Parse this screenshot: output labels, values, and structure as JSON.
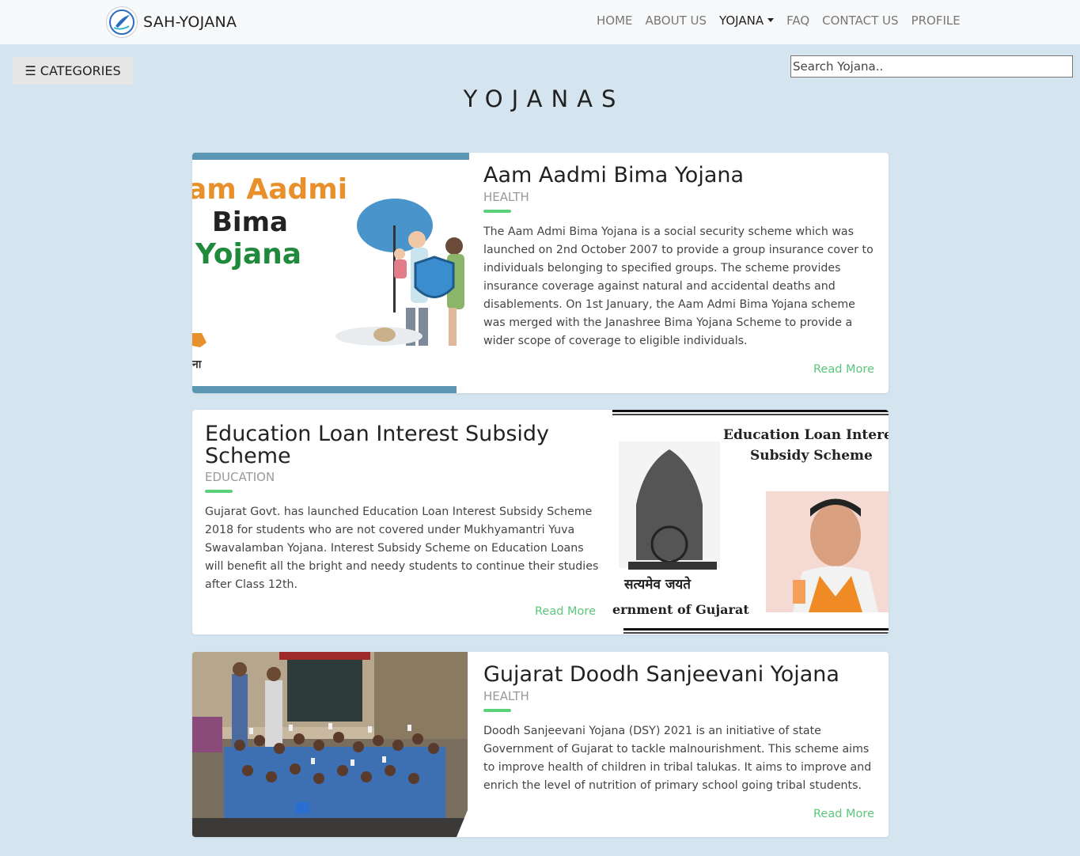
{
  "brand": {
    "name": "SAH-YOJANA"
  },
  "nav": [
    "HOME",
    "ABOUT US",
    "YOJANA",
    "FAQ",
    "CONTACT US",
    "PROFILE"
  ],
  "categories_button": "☰ CATEGORIES",
  "search": {
    "placeholder": "Search Yojana.."
  },
  "page_title": "YOJANAS",
  "cards": [
    {
      "title": "Aam Aadmi Bima Yojana",
      "category": "HEALTH",
      "description": "The Aam Admi Bima Yojana is a social security scheme which was launched on 2nd October 2007 to provide a group insurance cover to individuals belonging to specified groups. The scheme provides insurance coverage against natural and accidental deaths and disablements. On 1st January, the Aam Admi Bima Yojana scheme was merged with the Janashree Bima Yojana Scheme to provide a wider scope of coverage to eligible individuals.",
      "read_more": "Read More",
      "image_text": [
        "am Aadmi",
        "Bima",
        "Yojana"
      ]
    },
    {
      "title": "Education Loan Interest Subsidy Scheme",
      "category": "EDUCATION",
      "description": "Gujarat Govt. has launched Education Loan Interest Subsidy Scheme 2018 for students who are not covered under Mukhyamantri Yuva Swavalamban Yojana. Interest Subsidy Scheme on Education Loans will benefit all the bright and needy students to continue their studies after Class 12th.",
      "read_more": "Read More",
      "image_text": [
        "Education Loan Interes",
        "Subsidy Scheme",
        "सत्यमेव जयते",
        "ernment of Gujarat"
      ]
    },
    {
      "title": "Gujarat Doodh Sanjeevani Yojana",
      "category": "HEALTH",
      "description": "Doodh Sanjeevani Yojana (DSY) 2021 is an initiative of state Government of Gujarat to tackle malnourishment. This scheme aims to improve health of children in tribal talukas. It aims to improve and enrich the level of nutrition of primary school going tribal students.",
      "read_more": "Read More"
    }
  ]
}
